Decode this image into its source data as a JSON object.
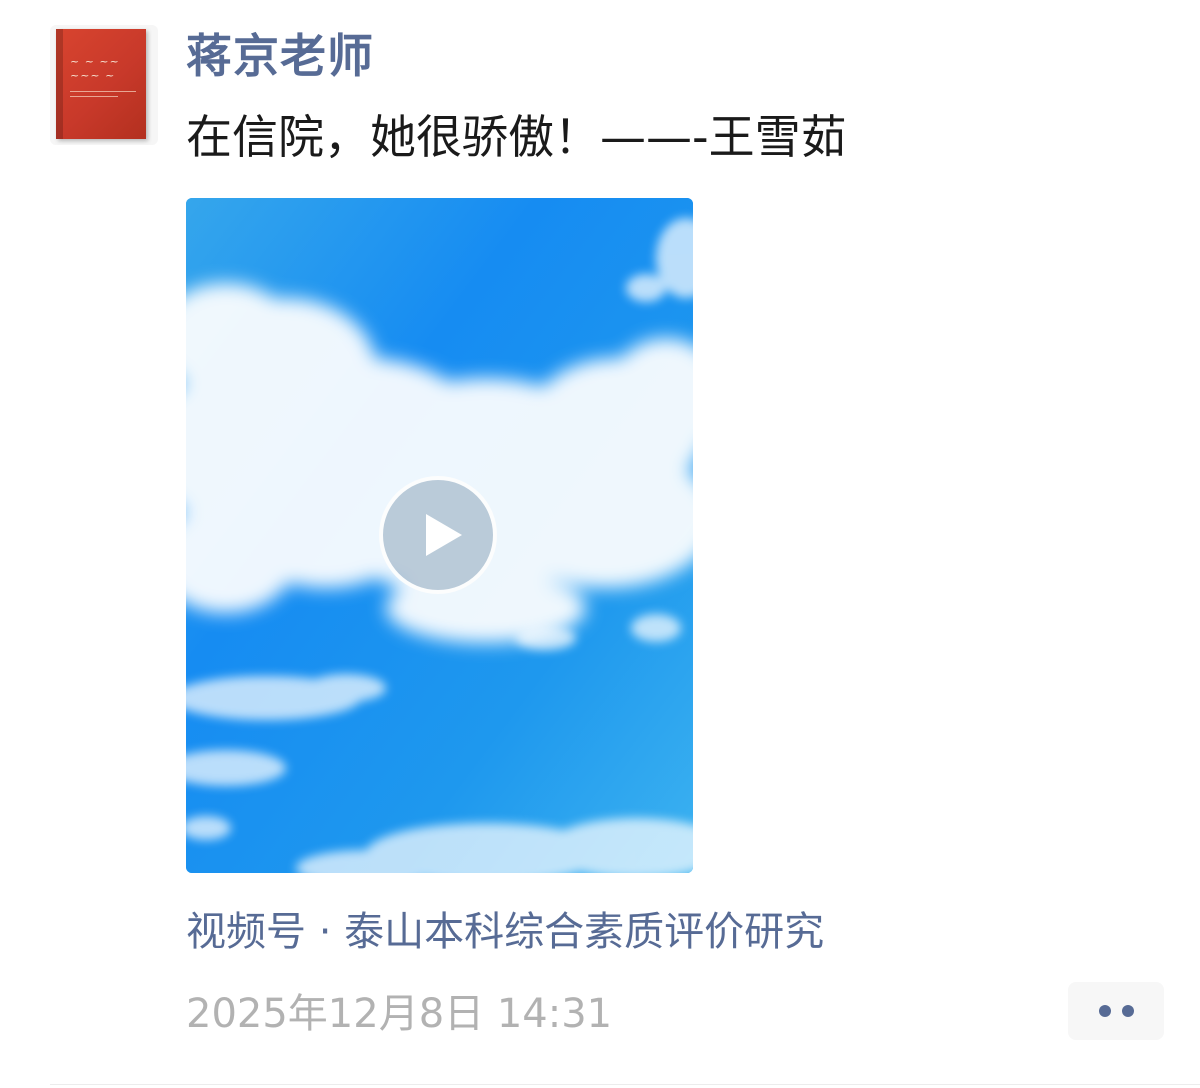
{
  "post": {
    "author_name": "蒋京老师",
    "text": "在信院，她很骄傲！——-王雪茹",
    "video": {
      "play_icon": "play-icon"
    },
    "channel_link": "视频号 · 泰山本科综合素质评价研究",
    "timestamp": "2025年12月8日 14:31",
    "more_icon": "more-dots-icon"
  },
  "colors": {
    "link": "#576b95",
    "text": "#1a1a1a",
    "muted": "#b2b2b2",
    "sky": "#1a8ff0",
    "avatar_book": "#c8392a"
  }
}
